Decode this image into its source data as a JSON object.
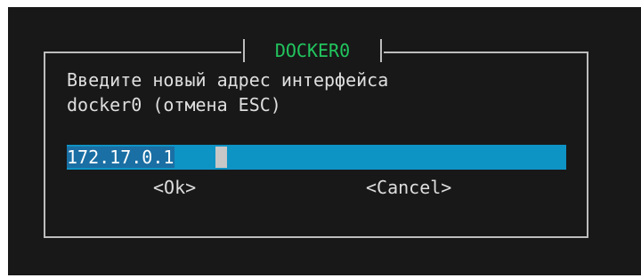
{
  "dialog": {
    "title": "DOCKER0",
    "prompt_line1": "Введите новый адрес интерфейса",
    "prompt_line2": "docker0 (отмена ESC)"
  },
  "input": {
    "value": "172.17.0.1"
  },
  "buttons": {
    "ok_label": "<Ok>",
    "cancel_label": "<Cancel>"
  },
  "colors": {
    "background": "#181818",
    "title": "#22c55e",
    "input_background": "#0e93c5",
    "frame": "#bdbdbd"
  }
}
